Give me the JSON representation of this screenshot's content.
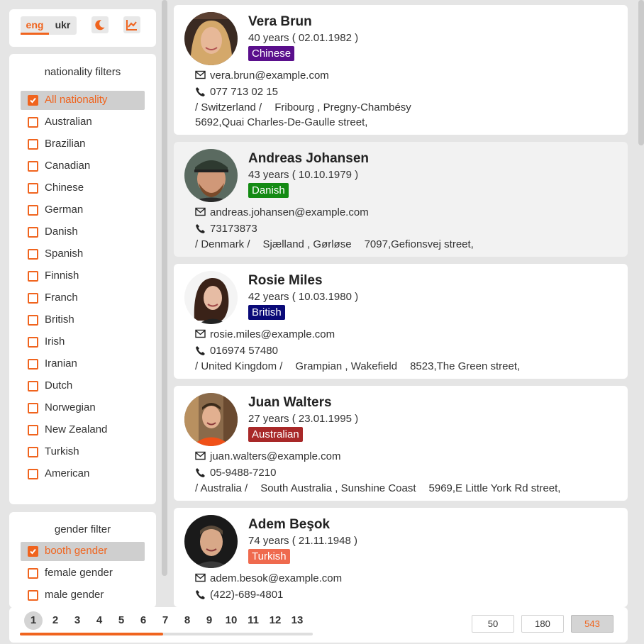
{
  "colors": {
    "accent": "#f0641e",
    "panel": "#ffffff",
    "background": "#e5e5e5",
    "selected": "#cfcfcf"
  },
  "header": {
    "lang_eng": "eng",
    "lang_ukr": "ukr",
    "active_lang": "eng",
    "theme_icon": "moon-icon",
    "stats_icon": "chart-line-icon"
  },
  "nationality_filters": {
    "title": "nationality filters",
    "items": [
      {
        "label": "All nationality",
        "checked": true
      },
      {
        "label": "Australian",
        "checked": false
      },
      {
        "label": "Brazilian",
        "checked": false
      },
      {
        "label": "Canadian",
        "checked": false
      },
      {
        "label": "Chinese",
        "checked": false
      },
      {
        "label": "German",
        "checked": false
      },
      {
        "label": "Danish",
        "checked": false
      },
      {
        "label": "Spanish",
        "checked": false
      },
      {
        "label": "Finnish",
        "checked": false
      },
      {
        "label": "Franch",
        "checked": false
      },
      {
        "label": "British",
        "checked": false
      },
      {
        "label": "Irish",
        "checked": false
      },
      {
        "label": "Iranian",
        "checked": false
      },
      {
        "label": "Dutch",
        "checked": false
      },
      {
        "label": "Norwegian",
        "checked": false
      },
      {
        "label": "New Zealand",
        "checked": false
      },
      {
        "label": "Turkish",
        "checked": false
      },
      {
        "label": "American",
        "checked": false
      }
    ]
  },
  "gender_filter": {
    "title": "gender filter",
    "items": [
      {
        "label": "booth gender",
        "checked": true
      },
      {
        "label": "female gender",
        "checked": false
      },
      {
        "label": "male gender",
        "checked": false
      }
    ]
  },
  "users": [
    {
      "name": "Vera Brun",
      "age": "40 years ( 02.01.1982 )",
      "nationality": "Chinese",
      "badge_color": "#5a0f8c",
      "email": "vera.brun@example.com",
      "phone": "077 713 02 15",
      "country": "/ Switzerland /",
      "region": "Fribourg , Pregny-Chambésy",
      "street": "5692,Quai Charles-De-Gaulle street,"
    },
    {
      "name": "Andreas Johansen",
      "age": "43 years ( 10.10.1979 )",
      "nationality": "Danish",
      "badge_color": "#138a13",
      "email": "andreas.johansen@example.com",
      "phone": "73173873",
      "country": "/ Denmark /",
      "region": "Sjælland , Gørløse",
      "street": "7097,Gefionsvej street,"
    },
    {
      "name": "Rosie Miles",
      "age": "42 years ( 10.03.1980 )",
      "nationality": "British",
      "badge_color": "#0a0a78",
      "email": "rosie.miles@example.com",
      "phone": "016974 57480",
      "country": "/ United Kingdom /",
      "region": "Grampian , Wakefield",
      "street": "8523,The Green street,"
    },
    {
      "name": "Juan Walters",
      "age": "27 years ( 23.01.1995 )",
      "nationality": "Australian",
      "badge_color": "#a82828",
      "email": "juan.walters@example.com",
      "phone": "05-9488-7210",
      "country": "/ Australia /",
      "region": "South Australia , Sunshine Coast",
      "street": "5969,E Little York Rd street,"
    },
    {
      "name": "Adem Beşok",
      "age": "74 years ( 21.11.1948 )",
      "nationality": "Turkish",
      "badge_color": "#ef6a4e",
      "email": "adem.besok@example.com",
      "phone": "(422)-689-4801",
      "country": "",
      "region": "",
      "street": ""
    }
  ],
  "pagination": {
    "pages": [
      "1",
      "2",
      "3",
      "4",
      "5",
      "6",
      "7",
      "8",
      "9",
      "10",
      "11",
      "12",
      "13"
    ],
    "current": "1",
    "scroll_progress": 0.49,
    "page_sizes": [
      "50",
      "180",
      "543"
    ],
    "active_size": "543"
  }
}
